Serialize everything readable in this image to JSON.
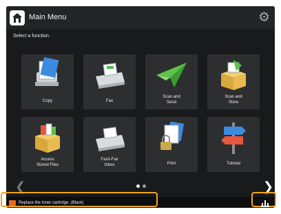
{
  "header": {
    "title": "Main Menu",
    "home_icon": "home-icon",
    "settings_icon": "gear-icon"
  },
  "instruction": "Select a function.",
  "functions": [
    {
      "label": "Copy",
      "icon": "copy-icon"
    },
    {
      "label": "Fax",
      "icon": "fax-icon"
    },
    {
      "label": "Scan and\nSend",
      "icon": "scan-send-icon"
    },
    {
      "label": "Scan and\nStore",
      "icon": "scan-store-icon"
    },
    {
      "label": "Access\nStored Files",
      "icon": "stored-files-icon"
    },
    {
      "label": "Fax/I-Fax\nInbox",
      "icon": "fax-inbox-icon"
    },
    {
      "label": "Print",
      "icon": "print-icon"
    },
    {
      "label": "Tutorial",
      "icon": "tutorial-icon"
    }
  ],
  "pagination": {
    "current_page": 1,
    "total_pages": 2
  },
  "status": {
    "message": "Replace the toner cartridge. (Black)",
    "icon": "toner-warning-icon"
  },
  "colors": {
    "highlight": "#f0a523",
    "screen_bg": "#191a1c",
    "tile_bg": "#2d2e30"
  }
}
